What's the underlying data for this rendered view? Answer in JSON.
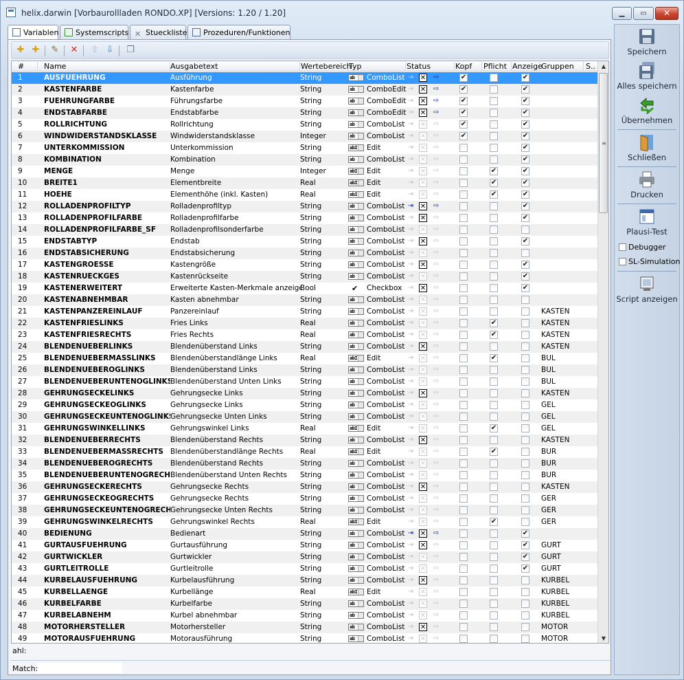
{
  "window": {
    "title": "helix.darwin [Vorbaurollladen RONDO.XP] [Versions: 1.20 / 1.20]"
  },
  "tabs": [
    {
      "label": "Variablen",
      "icon": "variables-icon"
    },
    {
      "label": "Systemscripts",
      "icon": "scripts-icon"
    },
    {
      "label": "Stueckliste",
      "icon": "tools-icon"
    },
    {
      "label": "Prozeduren/Funktionen",
      "icon": "procedures-icon"
    }
  ],
  "columns": {
    "num": "#",
    "name": "Name",
    "out": "Ausgabetext",
    "wb": "Wertebereich",
    "typ": "Typ",
    "status": "Status",
    "kopf": "Kopf",
    "pflicht": "Pflicht",
    "anzeige": "Anzeige",
    "gruppen": "Gruppen",
    "s": "S.."
  },
  "rows": [
    {
      "n": "1",
      "name": "AUSFUEHRUNG",
      "out": "Ausführung",
      "wb": "String",
      "typ": "ComboList",
      "st": [
        0,
        1,
        1
      ],
      "k": 1,
      "p": 0,
      "a": 1,
      "g": ""
    },
    {
      "n": "2",
      "name": "KASTENFARBE",
      "out": "Kastenfarbe",
      "wb": "String",
      "typ": "ComboEdit",
      "st": [
        0,
        1,
        1
      ],
      "k": 1,
      "p": 0,
      "a": 1,
      "g": ""
    },
    {
      "n": "3",
      "name": "FUEHRUNGFARBE",
      "out": "Führungsfarbe",
      "wb": "String",
      "typ": "ComboEdit",
      "st": [
        0,
        1,
        1
      ],
      "k": 1,
      "p": 0,
      "a": 1,
      "g": ""
    },
    {
      "n": "4",
      "name": "ENDSTABFARBE",
      "out": "Endstabfarbe",
      "wb": "String",
      "typ": "ComboEdit",
      "st": [
        0,
        1,
        1
      ],
      "k": 1,
      "p": 0,
      "a": 1,
      "g": ""
    },
    {
      "n": "5",
      "name": "ROLLRICHTUNG",
      "out": "Rollrichtung",
      "wb": "String",
      "typ": "ComboList",
      "st": [
        0,
        0,
        0
      ],
      "k": 1,
      "p": 0,
      "a": 1,
      "g": ""
    },
    {
      "n": "6",
      "name": "WINDWIDERSTANDSKLASSE",
      "out": "Windwiderstandsklasse",
      "wb": "Integer",
      "typ": "ComboList",
      "st": [
        0,
        0,
        0
      ],
      "k": 1,
      "p": 0,
      "a": 1,
      "g": ""
    },
    {
      "n": "7",
      "name": "UNTERKOMMISSION",
      "out": "Unterkommission",
      "wb": "String",
      "typ": "Edit",
      "st": [
        0,
        0,
        0
      ],
      "k": 0,
      "p": 0,
      "a": 1,
      "g": ""
    },
    {
      "n": "8",
      "name": "KOMBINATION",
      "out": "Kombination",
      "wb": "String",
      "typ": "ComboList",
      "st": [
        0,
        0,
        0
      ],
      "k": 0,
      "p": 0,
      "a": 1,
      "g": ""
    },
    {
      "n": "9",
      "name": "MENGE",
      "out": "Menge",
      "wb": "Integer",
      "typ": "Edit",
      "st": [
        0,
        0,
        0
      ],
      "k": 0,
      "p": 1,
      "a": 1,
      "g": ""
    },
    {
      "n": "10",
      "name": "BREITE1",
      "out": "Elementbreite",
      "wb": "Real",
      "typ": "Edit",
      "st": [
        0,
        0,
        0
      ],
      "k": 0,
      "p": 1,
      "a": 1,
      "g": ""
    },
    {
      "n": "11",
      "name": "HOEHE",
      "out": "Elementhöhe (inkl. Kasten)",
      "wb": "Real",
      "typ": "Edit",
      "st": [
        0,
        0,
        0
      ],
      "k": 0,
      "p": 1,
      "a": 1,
      "g": ""
    },
    {
      "n": "12",
      "name": "ROLLADENPROFILTYP",
      "out": "Rolladenprofiltyp",
      "wb": "String",
      "typ": "ComboList",
      "st": [
        1,
        1,
        1
      ],
      "k": 0,
      "p": 0,
      "a": 1,
      "g": ""
    },
    {
      "n": "13",
      "name": "ROLLADENPROFILFARBE",
      "out": "Rolladenprofilfarbe",
      "wb": "String",
      "typ": "ComboList",
      "st": [
        0,
        1,
        0
      ],
      "k": 0,
      "p": 0,
      "a": 1,
      "g": ""
    },
    {
      "n": "14",
      "name": "ROLLADENPROFILFARBE_SF",
      "out": "Rolladenprofilsonderfarbe",
      "wb": "String",
      "typ": "ComboList",
      "st": [
        0,
        0,
        0
      ],
      "k": 0,
      "p": 0,
      "a": 0,
      "g": ""
    },
    {
      "n": "15",
      "name": "ENDSTABTYP",
      "out": "Endstab",
      "wb": "String",
      "typ": "ComboList",
      "st": [
        0,
        1,
        0
      ],
      "k": 0,
      "p": 0,
      "a": 1,
      "g": ""
    },
    {
      "n": "16",
      "name": "ENDSTABSICHERUNG",
      "out": "Endstabsicherung",
      "wb": "String",
      "typ": "ComboList",
      "st": [
        0,
        0,
        0
      ],
      "k": 0,
      "p": 0,
      "a": 0,
      "g": ""
    },
    {
      "n": "17",
      "name": "KASTENGROESSE",
      "out": "Kastengröße",
      "wb": "String",
      "typ": "ComboList",
      "st": [
        0,
        1,
        0
      ],
      "k": 0,
      "p": 0,
      "a": 1,
      "g": ""
    },
    {
      "n": "18",
      "name": "KASTENRUECKGES",
      "out": "Kastenrückseite",
      "wb": "String",
      "typ": "ComboList",
      "st": [
        0,
        0,
        0
      ],
      "k": 0,
      "p": 0,
      "a": 1,
      "g": ""
    },
    {
      "n": "19",
      "name": "KASTENERWEITERT",
      "out": "Erweiterte Kasten-Merkmale anzeigen",
      "wb": "Bool",
      "typ": "Checkbox",
      "st": [
        0,
        1,
        0
      ],
      "k": 0,
      "p": 0,
      "a": 1,
      "g": ""
    },
    {
      "n": "20",
      "name": "KASTENABNEHMBAR",
      "out": "Kasten abnehmbar",
      "wb": "String",
      "typ": "ComboList",
      "st": [
        0,
        0,
        0
      ],
      "k": 0,
      "p": 0,
      "a": 0,
      "g": ""
    },
    {
      "n": "21",
      "name": "KASTENPANZEREINLAUF",
      "out": "Panzereinlauf",
      "wb": "String",
      "typ": "ComboList",
      "st": [
        0,
        0,
        0
      ],
      "k": 0,
      "p": 0,
      "a": 0,
      "g": "KASTEN"
    },
    {
      "n": "22",
      "name": "KASTENFRIESLINKS",
      "out": "Fries Links",
      "wb": "Real",
      "typ": "ComboList",
      "st": [
        0,
        0,
        0
      ],
      "k": 0,
      "p": 1,
      "a": 0,
      "g": "KASTEN"
    },
    {
      "n": "23",
      "name": "KASTENFRIESRECHTS",
      "out": "Fries Rechts",
      "wb": "Real",
      "typ": "ComboList",
      "st": [
        0,
        0,
        0
      ],
      "k": 0,
      "p": 1,
      "a": 0,
      "g": "KASTEN"
    },
    {
      "n": "24",
      "name": "BLENDENUEBERLINKS",
      "out": "Blendenüberstand Links",
      "wb": "String",
      "typ": "ComboList",
      "st": [
        0,
        1,
        0
      ],
      "k": 0,
      "p": 0,
      "a": 0,
      "g": "KASTEN"
    },
    {
      "n": "25",
      "name": "BLENDENUEBERMASSLINKS",
      "out": "Blendenüberstandlänge Links",
      "wb": "Real",
      "typ": "Edit",
      "st": [
        0,
        0,
        0
      ],
      "k": 0,
      "p": 1,
      "a": 0,
      "g": "BUL"
    },
    {
      "n": "26",
      "name": "BLENDENUEBEROGLINKS",
      "out": "Blendenüberstand Links",
      "wb": "String",
      "typ": "ComboList",
      "st": [
        0,
        0,
        0
      ],
      "k": 0,
      "p": 0,
      "a": 0,
      "g": "BUL"
    },
    {
      "n": "27",
      "name": "BLENDENUEBERUNTENOGLINKS",
      "out": "Blendenüberstand Unten Links",
      "wb": "String",
      "typ": "ComboList",
      "st": [
        0,
        0,
        0
      ],
      "k": 0,
      "p": 0,
      "a": 0,
      "g": "BUL"
    },
    {
      "n": "28",
      "name": "GEHRUNGSECKELINKS",
      "out": "Gehrungsecke Links",
      "wb": "String",
      "typ": "ComboList",
      "st": [
        0,
        1,
        0
      ],
      "k": 0,
      "p": 0,
      "a": 0,
      "g": "KASTEN"
    },
    {
      "n": "29",
      "name": "GEHRUNGSECKEOGLINKS",
      "out": "Gehrungsecke Links",
      "wb": "String",
      "typ": "ComboList",
      "st": [
        0,
        0,
        0
      ],
      "k": 0,
      "p": 0,
      "a": 0,
      "g": "GEL"
    },
    {
      "n": "30",
      "name": "GEHRUNGSECKEUNTENOGLINKS",
      "out": "Gehrungsecke Unten Links",
      "wb": "String",
      "typ": "ComboList",
      "st": [
        0,
        0,
        0
      ],
      "k": 0,
      "p": 0,
      "a": 0,
      "g": "GEL"
    },
    {
      "n": "31",
      "name": "GEHRUNGSWINKELLINKS",
      "out": "Gehrungswinkel Links",
      "wb": "Real",
      "typ": "Edit",
      "st": [
        0,
        0,
        0
      ],
      "k": 0,
      "p": 1,
      "a": 0,
      "g": "GEL"
    },
    {
      "n": "32",
      "name": "BLENDENUEBERRECHTS",
      "out": "Blendenüberstand Rechts",
      "wb": "String",
      "typ": "ComboList",
      "st": [
        0,
        1,
        0
      ],
      "k": 0,
      "p": 0,
      "a": 0,
      "g": "KASTEN"
    },
    {
      "n": "33",
      "name": "BLENDENUEBERMASSRECHTS",
      "out": "Blendenüberstandlänge Rechts",
      "wb": "Real",
      "typ": "Edit",
      "st": [
        0,
        0,
        0
      ],
      "k": 0,
      "p": 1,
      "a": 0,
      "g": "BUR"
    },
    {
      "n": "34",
      "name": "BLENDENUEBEROGRECHTS",
      "out": "Blendenüberstand Rechts",
      "wb": "String",
      "typ": "ComboList",
      "st": [
        0,
        0,
        0
      ],
      "k": 0,
      "p": 0,
      "a": 0,
      "g": "BUR"
    },
    {
      "n": "35",
      "name": "BLENDENUEBERUNTENOGRECHTS",
      "out": "Blendenüberstand Unten Rechts",
      "wb": "String",
      "typ": "ComboList",
      "st": [
        0,
        0,
        0
      ],
      "k": 0,
      "p": 0,
      "a": 0,
      "g": "BUR"
    },
    {
      "n": "36",
      "name": "GEHRUNGSECKERECHTS",
      "out": "Gehrungsecke Rechts",
      "wb": "String",
      "typ": "ComboList",
      "st": [
        0,
        1,
        0
      ],
      "k": 0,
      "p": 0,
      "a": 0,
      "g": "KASTEN"
    },
    {
      "n": "37",
      "name": "GEHRUNGSECKEOGRECHTS",
      "out": "Gehrungsecke Rechts",
      "wb": "String",
      "typ": "ComboList",
      "st": [
        0,
        0,
        0
      ],
      "k": 0,
      "p": 0,
      "a": 0,
      "g": "GER"
    },
    {
      "n": "38",
      "name": "GEHRUNGSECKEUNTENOGRECHTS",
      "out": "Gehrungsecke Unten Rechts",
      "wb": "String",
      "typ": "ComboList",
      "st": [
        0,
        0,
        0
      ],
      "k": 0,
      "p": 0,
      "a": 0,
      "g": "GER"
    },
    {
      "n": "39",
      "name": "GEHRUNGSWINKELRECHTS",
      "out": "Gehrungswinkel Rechts",
      "wb": "Real",
      "typ": "Edit",
      "st": [
        0,
        0,
        0
      ],
      "k": 0,
      "p": 1,
      "a": 0,
      "g": "GER"
    },
    {
      "n": "40",
      "name": "BEDIENUNG",
      "out": "Bedienart",
      "wb": "String",
      "typ": "ComboList",
      "st": [
        1,
        1,
        1
      ],
      "k": 0,
      "p": 0,
      "a": 1,
      "g": ""
    },
    {
      "n": "41",
      "name": "GURTAUSFUEHRUNG",
      "out": "Gurtausführung",
      "wb": "String",
      "typ": "ComboList",
      "st": [
        0,
        1,
        0
      ],
      "k": 0,
      "p": 0,
      "a": 1,
      "g": "GURT"
    },
    {
      "n": "42",
      "name": "GURTWICKLER",
      "out": "Gurtwickler",
      "wb": "String",
      "typ": "ComboList",
      "st": [
        0,
        0,
        0
      ],
      "k": 0,
      "p": 0,
      "a": 1,
      "g": "GURT"
    },
    {
      "n": "43",
      "name": "GURTLEITROLLE",
      "out": "Gurtleitrolle",
      "wb": "String",
      "typ": "ComboList",
      "st": [
        0,
        0,
        0
      ],
      "k": 0,
      "p": 0,
      "a": 1,
      "g": "GURT"
    },
    {
      "n": "44",
      "name": "KURBELAUSFUEHRUNG",
      "out": "Kurbelausführung",
      "wb": "String",
      "typ": "ComboList",
      "st": [
        0,
        1,
        0
      ],
      "k": 0,
      "p": 0,
      "a": 0,
      "g": "KURBEL"
    },
    {
      "n": "45",
      "name": "KURBELLAENGE",
      "out": "Kurbellänge",
      "wb": "Real",
      "typ": "Edit",
      "st": [
        0,
        0,
        0
      ],
      "k": 0,
      "p": 0,
      "a": 0,
      "g": "KURBEL"
    },
    {
      "n": "46",
      "name": "KURBELFARBE",
      "out": "Kurbelfarbe",
      "wb": "String",
      "typ": "ComboList",
      "st": [
        0,
        0,
        0
      ],
      "k": 0,
      "p": 0,
      "a": 0,
      "g": "KURBEL"
    },
    {
      "n": "47",
      "name": "KURBELABNEHM",
      "out": "Kurbel abnehmbar",
      "wb": "String",
      "typ": "ComboList",
      "st": [
        0,
        0,
        0
      ],
      "k": 0,
      "p": 0,
      "a": 0,
      "g": "KURBEL"
    },
    {
      "n": "48",
      "name": "MOTORHERSTELLER",
      "out": "Motorhersteller",
      "wb": "String",
      "typ": "ComboList",
      "st": [
        0,
        1,
        0
      ],
      "k": 0,
      "p": 0,
      "a": 0,
      "g": "MOTOR"
    },
    {
      "n": "49",
      "name": "MOTORAUSFUEHRUNG",
      "out": "Motorausführung",
      "wb": "String",
      "typ": "ComboList",
      "st": [
        0,
        0,
        0
      ],
      "k": 0,
      "p": 0,
      "a": 0,
      "g": "MOTOR"
    }
  ],
  "footer": {
    "ahl": "ahl:",
    "match_label": "Match:",
    "match_value": ""
  },
  "sidebar": {
    "save": "Speichern",
    "save_all": "Alles speichern",
    "apply": "Übernehmen",
    "close": "Schließen",
    "print": "Drucken",
    "plausi": "Plausi-Test",
    "debugger": "Debugger",
    "sl_sim": "SL-Simulation",
    "script": "Script anzeigen"
  },
  "colors": {
    "selection": "#3399ff",
    "accent": "#1a2fb0"
  }
}
